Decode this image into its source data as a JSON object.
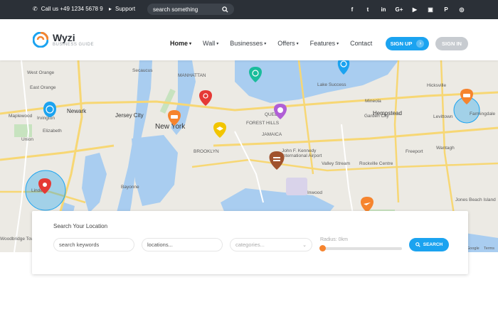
{
  "topbar": {
    "phone": "Call us +49 1234 5678 9",
    "support": "Support",
    "search_placeholder": "search something",
    "socials": [
      "f",
      "t",
      "in",
      "G+",
      "▶",
      "▣",
      "P",
      "◎"
    ]
  },
  "header": {
    "brand_name": "Wyzi",
    "brand_tagline": "BUSINESS GUIDE",
    "nav": [
      {
        "label": "Home",
        "dropdown": true,
        "active": true
      },
      {
        "label": "Wall",
        "dropdown": true,
        "active": false
      },
      {
        "label": "Businesses",
        "dropdown": true,
        "active": false
      },
      {
        "label": "Offers",
        "dropdown": true,
        "active": false
      },
      {
        "label": "Features",
        "dropdown": true,
        "active": false
      },
      {
        "label": "Contact",
        "dropdown": false,
        "active": false
      }
    ],
    "signup_label": "SIGN UP",
    "signin_label": "SIGN IN"
  },
  "map": {
    "labels": {
      "west_orange": "West Orange",
      "east_orange": "East Orange",
      "newark": "Newark",
      "jersey_city": "Jersey City",
      "new_york": "New York",
      "manhattan": "MANHATTAN",
      "queens": "QUEENS",
      "brooklyn": "BROOKLYN",
      "hempstead": "Hempstead",
      "elizabeth": "Elizabeth",
      "linden": "Linden",
      "woodbridge": "Woodbridge Township",
      "irvington": "Irvington",
      "maplewood": "Maplewood",
      "union": "Union",
      "jfk": "John F. Kennedy International Airport",
      "garden_city": "Garden City",
      "freeport": "Freeport",
      "levittown": "Levittown",
      "lake_success": "Lake Success",
      "mineola": "Mineola",
      "valley_stream": "Valley Stream",
      "rockville_centre": "Rockville Centre",
      "jones_beach": "Jones Beach Island",
      "inwood": "Inwood",
      "farmingdale": "Farmingdale",
      "hicksville": "Hicksville",
      "wantagh": "Wantagh",
      "secaucus": "Secaucus",
      "bayonne": "Bayonne",
      "forest_hills": "FOREST HILLS",
      "jamaica": "JAMAICA",
      "google": "Google",
      "terms": "Terms"
    },
    "markers": [
      {
        "icon": "globe-icon",
        "color": "#1ba3f0"
      },
      {
        "icon": "gas-icon",
        "color": "#e53935"
      },
      {
        "icon": "car-icon",
        "color": "#f6842e"
      },
      {
        "icon": "lightbulb-icon",
        "color": "#e53935"
      },
      {
        "icon": "clock-icon",
        "color": "#1abc9c"
      },
      {
        "icon": "palette-icon",
        "color": "#b05fd6"
      },
      {
        "icon": "graduation-icon",
        "color": "#f2c500"
      },
      {
        "icon": "burger-icon",
        "color": "#a0522d"
      },
      {
        "icon": "plane-icon",
        "color": "#f6842e"
      },
      {
        "icon": "globe-icon",
        "color": "#1ba3f0"
      },
      {
        "icon": "taxi-icon",
        "color": "#f6842e"
      },
      {
        "icon": "money-icon",
        "color": "#28a745"
      }
    ]
  },
  "search_panel": {
    "title": "Search Your Location",
    "keywords_placeholder": "search keywords",
    "locations_placeholder": "locations...",
    "categories_placeholder": "categories...",
    "radius_label": "Radius: 0km",
    "radius_value": 0,
    "search_label": "SEARCH"
  },
  "colors": {
    "accent": "#1ba3f0",
    "topbar": "#2b3037",
    "signin": "#c7cbd0",
    "slider": "#f6842e"
  }
}
